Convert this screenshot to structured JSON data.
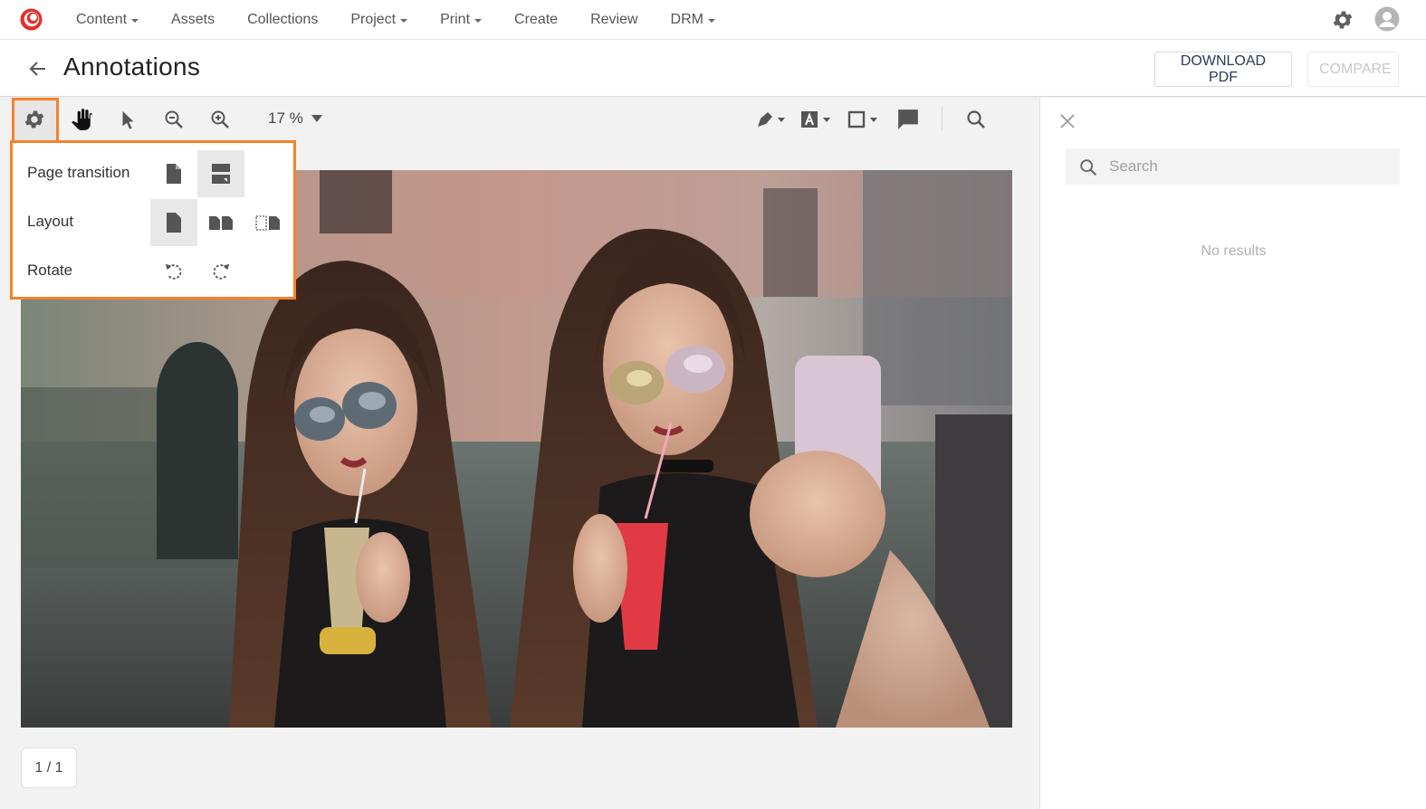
{
  "brand": {
    "accent": "#f5822a",
    "logo_color": "#e5302b"
  },
  "nav": {
    "items": [
      {
        "label": "Content",
        "dropdown": true
      },
      {
        "label": "Assets",
        "dropdown": false
      },
      {
        "label": "Collections",
        "dropdown": false
      },
      {
        "label": "Project",
        "dropdown": true
      },
      {
        "label": "Print",
        "dropdown": true
      },
      {
        "label": "Create",
        "dropdown": false
      },
      {
        "label": "Review",
        "dropdown": false
      },
      {
        "label": "DRM",
        "dropdown": true
      }
    ],
    "right_icons": [
      "gear-icon",
      "user-avatar-icon"
    ]
  },
  "header": {
    "title": "Annotations",
    "download_label": "DOWNLOAD PDF",
    "compare_label": "COMPARE"
  },
  "toolbar": {
    "zoom": "17 %",
    "tools_left": [
      "gear-icon",
      "hand-icon",
      "pointer-icon",
      "zoom-out-icon",
      "zoom-in-icon"
    ],
    "tools_right": [
      "pen-icon",
      "text-box-icon",
      "rectangle-icon",
      "comment-icon",
      "search-icon"
    ],
    "active_tool": "hand-icon"
  },
  "settings_popover": {
    "page_transition": {
      "label": "Page transition",
      "options": [
        "single-page-icon",
        "continuous-scroll-icon"
      ],
      "selected": 1
    },
    "layout": {
      "label": "Layout",
      "options": [
        "single-page-icon",
        "two-page-icon",
        "cover-two-page-icon"
      ],
      "selected": 0
    },
    "rotate": {
      "label": "Rotate",
      "options": [
        "rotate-left-icon",
        "rotate-right-icon"
      ]
    }
  },
  "pager": {
    "text": "1 / 1"
  },
  "side_panel": {
    "search_placeholder": "Search",
    "empty_text": "No results"
  }
}
